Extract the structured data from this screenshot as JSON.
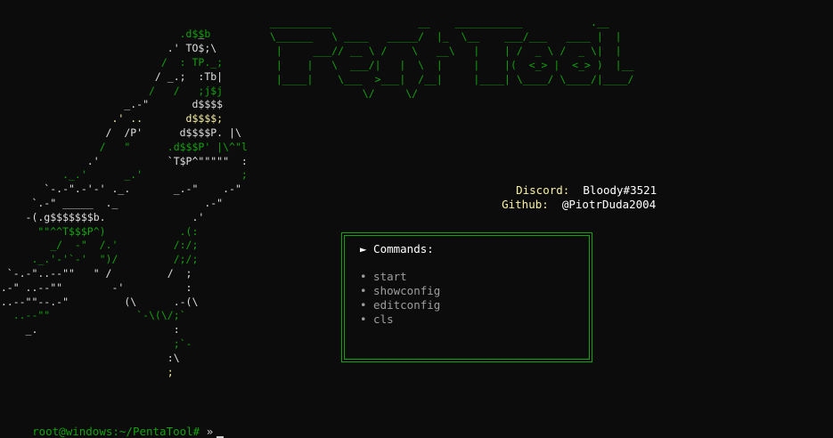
{
  "art": {
    "top": [
      {
        "t": "  _",
        "c": "c-w"
      },
      {
        "t": ".d$$b",
        "c": "c-g"
      },
      {
        "t": ".' TO$;\\",
        "c": "c-w"
      },
      {
        "t": "/  : TP._;",
        "c": "c-g"
      },
      {
        "t": "/ _.;  :Tb|",
        "c": "c-w"
      },
      {
        "t": "/   /   ;j$j",
        "c": "c-g"
      }
    ],
    "lines": [
      "                                  _",
      "                               .d$$b",
      "                             .' TO$;\\",
      "                            /  : TP._;",
      "                           / _.;  :Tb|",
      "                          /   /   ;j$j",
      "                      _.-\"       d$$$$",
      "                    .' ..       d$$$$;",
      "                   /  /P'      d$$$$P. |\\",
      "                  /   \"      .d$$$P' |\\^\"l",
      "                .'           `T$P^\"\"\"\"\"  :",
      "            ._.'      _.'                ;",
      "         `-.-\".-'-' ._.       _.-\"    .-\"",
      "       `.-\" _____  ._              .-\"",
      "      -(.g$$$$$$$b.              .'",
      "        \"\"^^T$$$P^)            .(:",
      "          _/  -\"  /.'         /:/;",
      "       ._.'-'`-'  \")/         /;/;",
      "   `-.-\"..--\"\"   \" /         /  ;",
      "  .-\" ..--\"\"        -'          :",
      "  ..--\"\"--.-\"         (\\      .-(\\",
      "    ..--\"\"              `-\\(\\/;`",
      "      _.                      :",
      "                              ;`-",
      "                             :\\",
      "                             ;"
    ]
  },
  "logo": {
    "lines": [
      " __________              __    ___________           .__   ",
      " \\______   \\ ____   _____/  |_  \\__    ___/___   ____ |  |  ",
      "  |     ___// __ \\ /    \\   __\\   |    | /  _ \\ /  _ \\|  |  ",
      "  |    |   \\  ___/|   |  \\  |     |    |(  <_> |  <_> )  |__",
      "  |____|    \\___  >___|  /__|     |____| \\____/ \\____/|____/",
      "                \\/     \\/                                     "
    ]
  },
  "info": {
    "discord_label": "Discord:",
    "discord_value": "Bloody#3521",
    "github_label": "Github:",
    "github_value": "@PiotrDuda2004"
  },
  "commands": {
    "title": "► Commands:",
    "items": [
      "• start",
      "• showconfig",
      "• editconfig",
      "• cls"
    ]
  },
  "prompt": {
    "path": "root@windows:~/PentaTool#",
    "arrow": "»"
  },
  "colors": {
    "background": "#0c0c0c",
    "green": "#13a10e",
    "yellow": "#f9f1a5",
    "white": "#ffffff",
    "gray": "#9d9d9d"
  }
}
